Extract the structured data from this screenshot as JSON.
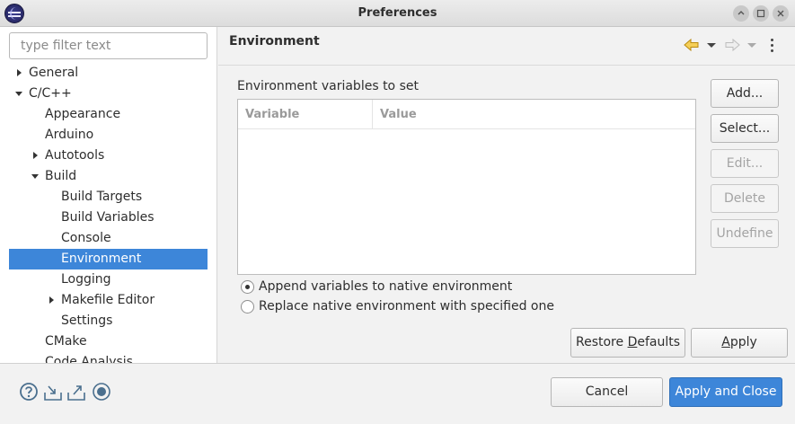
{
  "window": {
    "title": "Preferences"
  },
  "filter": {
    "placeholder": "type filter text"
  },
  "tree": [
    {
      "label": "General",
      "depth": 0,
      "state": "collapsed"
    },
    {
      "label": "C/C++",
      "depth": 0,
      "state": "expanded"
    },
    {
      "label": "Appearance",
      "depth": 1,
      "state": "leaf"
    },
    {
      "label": "Arduino",
      "depth": 1,
      "state": "leaf"
    },
    {
      "label": "Autotools",
      "depth": 1,
      "state": "collapsed"
    },
    {
      "label": "Build",
      "depth": 1,
      "state": "expanded"
    },
    {
      "label": "Build Targets",
      "depth": 2,
      "state": "leaf"
    },
    {
      "label": "Build Variables",
      "depth": 2,
      "state": "leaf"
    },
    {
      "label": "Console",
      "depth": 2,
      "state": "leaf"
    },
    {
      "label": "Environment",
      "depth": 2,
      "state": "leaf",
      "selected": true
    },
    {
      "label": "Logging",
      "depth": 2,
      "state": "leaf"
    },
    {
      "label": "Makefile Editor",
      "depth": 2,
      "state": "collapsed"
    },
    {
      "label": "Settings",
      "depth": 2,
      "state": "leaf"
    },
    {
      "label": "CMake",
      "depth": 1,
      "state": "leaf"
    },
    {
      "label": "Code Analysis",
      "depth": 1,
      "state": "leaf"
    }
  ],
  "page": {
    "title": "Environment",
    "section_label": "Environment variables to set",
    "table": {
      "columns": [
        "Variable",
        "Value"
      ],
      "rows": []
    },
    "side_buttons": [
      {
        "label": "Add...",
        "enabled": true
      },
      {
        "label": "Select...",
        "enabled": true
      },
      {
        "label": "Edit...",
        "enabled": false
      },
      {
        "label": "Delete",
        "enabled": false
      },
      {
        "label": "Undefine",
        "enabled": false
      }
    ],
    "radios": [
      {
        "label": "Append variables to native environment",
        "checked": true
      },
      {
        "label": "Replace native environment with specified one",
        "checked": false
      }
    ],
    "restore_defaults_label": "Restore Defaults",
    "apply_label": "Apply"
  },
  "footer": {
    "cancel_label": "Cancel",
    "apply_close_label": "Apply and Close",
    "icons": [
      "help-icon",
      "import-icon",
      "export-icon",
      "record-icon"
    ]
  },
  "colors": {
    "selection": "#3d86d9",
    "nav_accent": "#e0a020"
  }
}
